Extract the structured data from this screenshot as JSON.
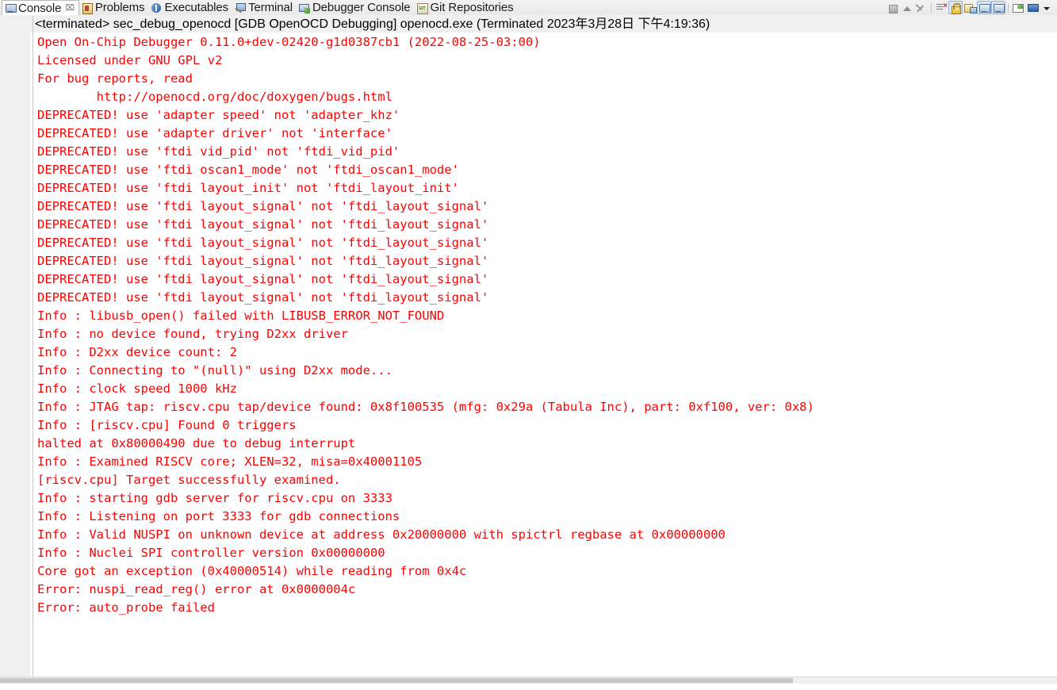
{
  "tabbar": {
    "tabs": [
      {
        "label": "Console",
        "icon": "console-icon",
        "active": true,
        "closeable": true
      },
      {
        "label": "Problems",
        "icon": "problems-icon",
        "active": false,
        "closeable": false
      },
      {
        "label": "Executables",
        "icon": "executables-icon",
        "active": false,
        "closeable": false
      },
      {
        "label": "Terminal",
        "icon": "terminal-icon",
        "active": false,
        "closeable": false
      },
      {
        "label": "Debugger Console",
        "icon": "debugger-console-icon",
        "active": false,
        "closeable": false
      },
      {
        "label": "Git Repositories",
        "icon": "git-repositories-icon",
        "active": false,
        "closeable": false
      }
    ],
    "close_glyph": "⌧"
  },
  "toolbar": {
    "buttons": [
      {
        "name": "terminate-button",
        "icon": "stop-icon",
        "toggled": false
      },
      {
        "name": "remove-launch-button",
        "icon": "chevron-up-icon",
        "toggled": false
      },
      {
        "name": "remove-all-terminated-button",
        "icon": "remove-all-terminated-icon",
        "toggled": false
      },
      {
        "name": "clear-console-button",
        "icon": "clear-console-icon",
        "toggled": false
      },
      {
        "name": "scroll-lock-button",
        "icon": "lock-icon",
        "toggled": true
      },
      {
        "name": "show-console-on-output-button",
        "icon": "show-console-on-output-icon",
        "toggled": false
      },
      {
        "name": "pin-console-button",
        "icon": "monitor-icon",
        "toggled": true
      },
      {
        "name": "display-selected-console-button",
        "icon": "monitor-icon",
        "toggled": true
      },
      {
        "name": "open-console-button",
        "icon": "new-console-view-icon",
        "toggled": false
      },
      {
        "name": "console-view-button",
        "icon": "open-console-icon",
        "toggled": false
      },
      {
        "name": "view-menu-button",
        "icon": "chevron-down-icon",
        "toggled": false
      }
    ],
    "window_buttons": [
      {
        "name": "minimize-view-button",
        "icon": "minimize-icon"
      },
      {
        "name": "maximize-view-button",
        "icon": "maximize-icon"
      }
    ]
  },
  "title": {
    "text": "<terminated> sec_debug_openocd [GDB OpenOCD Debugging] openocd.exe (Terminated 2023年3月28日 下午4:19:36)"
  },
  "console": {
    "text_color": "#ff0000",
    "lines": [
      "Open On-Chip Debugger 0.11.0+dev-02420-g1d0387cb1 (2022-08-25-03:00)",
      "Licensed under GNU GPL v2",
      "For bug reports, read",
      "        http://openocd.org/doc/doxygen/bugs.html",
      "DEPRECATED! use 'adapter speed' not 'adapter_khz'",
      "DEPRECATED! use 'adapter driver' not 'interface'",
      "DEPRECATED! use 'ftdi vid_pid' not 'ftdi_vid_pid'",
      "DEPRECATED! use 'ftdi oscan1_mode' not 'ftdi_oscan1_mode'",
      "DEPRECATED! use 'ftdi layout_init' not 'ftdi_layout_init'",
      "DEPRECATED! use 'ftdi layout_signal' not 'ftdi_layout_signal'",
      "DEPRECATED! use 'ftdi layout_signal' not 'ftdi_layout_signal'",
      "DEPRECATED! use 'ftdi layout_signal' not 'ftdi_layout_signal'",
      "DEPRECATED! use 'ftdi layout_signal' not 'ftdi_layout_signal'",
      "DEPRECATED! use 'ftdi layout_signal' not 'ftdi_layout_signal'",
      "DEPRECATED! use 'ftdi layout_signal' not 'ftdi_layout_signal'",
      "Info : libusb_open() failed with LIBUSB_ERROR_NOT_FOUND",
      "Info : no device found, trying D2xx driver",
      "Info : D2xx device count: 2",
      "Info : Connecting to \"(null)\" using D2xx mode...",
      "Info : clock speed 1000 kHz",
      "Info : JTAG tap: riscv.cpu tap/device found: 0x8f100535 (mfg: 0x29a (Tabula Inc), part: 0xf100, ver: 0x8)",
      "Info : [riscv.cpu] Found 0 triggers",
      "halted at 0x80000490 due to debug interrupt",
      "Info : Examined RISCV core; XLEN=32, misa=0x40001105",
      "[riscv.cpu] Target successfully examined.",
      "Info : starting gdb server for riscv.cpu on 3333",
      "Info : Listening on port 3333 for gdb connections",
      "Info : Valid NUSPI on unknown device at address 0x20000000 with spictrl regbase at 0x00000000",
      "Info : Nuclei SPI controller version 0x00000000",
      "Core got an exception (0x40000514) while reading from 0x4c",
      "Error: nuspi_read_reg() error at 0x0000004c",
      "Error: auto_probe failed"
    ]
  }
}
